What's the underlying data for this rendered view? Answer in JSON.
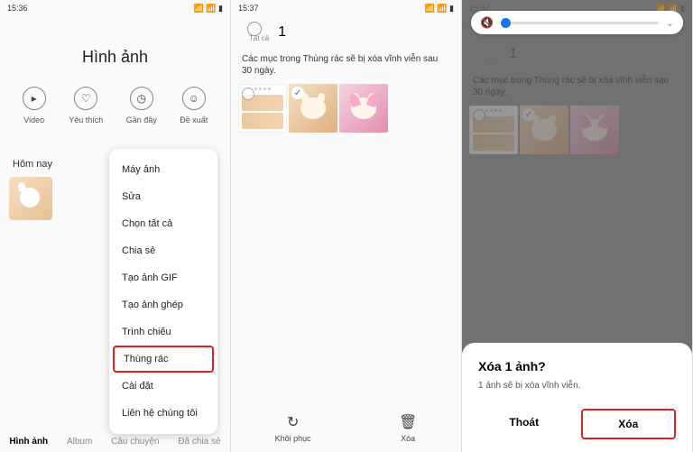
{
  "status": {
    "t1": "15:36",
    "t2": "15:37",
    "t3": "15:37"
  },
  "s1": {
    "title": "Hình ảnh",
    "actions": [
      {
        "label": "Video",
        "glyph": "▸"
      },
      {
        "label": "Yêu thích",
        "glyph": "♡"
      },
      {
        "label": "Gần đây",
        "glyph": "◷"
      },
      {
        "label": "Đề xuất",
        "glyph": "☺"
      }
    ],
    "section": "Hôm nay",
    "menu": [
      "Máy ảnh",
      "Sửa",
      "Chọn tất cả",
      "Chia sẻ",
      "Tạo ảnh GIF",
      "Tạo ảnh ghép",
      "Trình chiếu",
      "Thùng rác",
      "Cài đặt",
      "Liên hệ chúng tôi"
    ],
    "menu_highlight_index": 7,
    "tabs": [
      "Hình ảnh",
      "Album",
      "Câu chuyện",
      "Đã chia sẻ"
    ],
    "tab_active": 0
  },
  "s2": {
    "all_label": "Tất cả",
    "count": "1",
    "note": "Các mục trong Thùng rác sẽ bị xóa vĩnh viễn sau 30 ngày.",
    "restore": {
      "label": "Khôi phục",
      "glyph": "↻"
    },
    "delete": {
      "label": "Xóa",
      "glyph": "🗑"
    }
  },
  "s3": {
    "all_label": "Tất cả",
    "count": "1",
    "note": "Các mục trong Thùng rác sẽ bị xóa vĩnh viễn sau 30 ngày.",
    "dialog": {
      "title": "Xóa 1 ảnh?",
      "msg": "1 ảnh sẽ bị xóa vĩnh viễn.",
      "cancel": "Thoát",
      "confirm": "Xóa"
    }
  }
}
